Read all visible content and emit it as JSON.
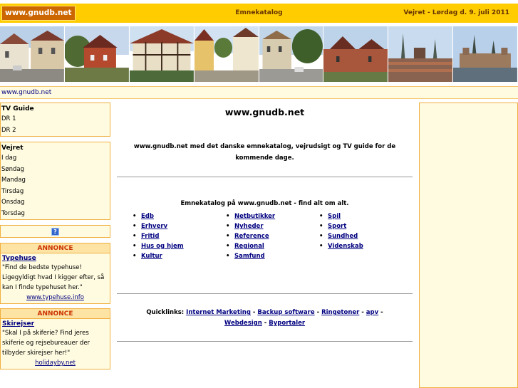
{
  "header": {
    "logo": "www.gnudb.net",
    "center": "Emnekatalog",
    "weather_date": "Vejret - Lørdag d. 9. juli 2011"
  },
  "banner": {
    "photos": [
      "street-photo",
      "village-photo",
      "timber-house-photo",
      "lane-photo",
      "square-photo",
      "castle-wall-photo",
      "city-skyline-photo",
      "castle-photo"
    ]
  },
  "breadcrumb": "www.gnudb.net",
  "tv": {
    "title": "TV Guide",
    "items": [
      "DR 1",
      "DR 2"
    ]
  },
  "weather": {
    "title": "Vejret",
    "items": [
      "I dag",
      "Søndag",
      "Mandag",
      "Tirsdag",
      "Onsdag",
      "Torsdag"
    ]
  },
  "help_icon": "?",
  "ads": [
    {
      "head": "ANNONCE",
      "title": "Typehuse",
      "text": "\"Find de bedste typehuse! Ligegyldigt hvad I kigger efter, så kan I finde typehuset her.\"",
      "link": "www.typehuse.info"
    },
    {
      "head": "ANNONCE",
      "title": "Skirejser",
      "text": "\"Skal I på skiferie? Find jeres skiferie og rejsebureauer der tilbyder skirejser her!\"",
      "link": "holidayby.net"
    }
  ],
  "main": {
    "title": "www.gnudb.net",
    "intro": "www.gnudb.net med det danske emnekatalog, vejrudsigt og TV guide for de kommende dage.",
    "cat_head": "Emnekatalog på www.gnudb.net - find alt om alt.",
    "col1": [
      "Edb",
      "Erhverv",
      "Fritid",
      "Hus og hjem",
      "Kultur"
    ],
    "col2": [
      "Netbutikker",
      "Nyheder",
      "Reference",
      "Regional",
      "Samfund"
    ],
    "col3": [
      "Spil",
      "Sport",
      "Sundhed",
      "Videnskab"
    ],
    "quick_label": "Quicklinks:",
    "quicklinks": [
      "Internet Marketing",
      "Backup software",
      "Ringetoner",
      "apv",
      "Webdesign",
      "Byportaler"
    ],
    "sep": " - "
  },
  "colors": {
    "topbar": "#ffcc00",
    "logo_bg": "#cc6600",
    "panel_bg": "#fffbe0",
    "panel_border": "#f0b040",
    "link": "#000080",
    "annonce": "#cc3300"
  }
}
